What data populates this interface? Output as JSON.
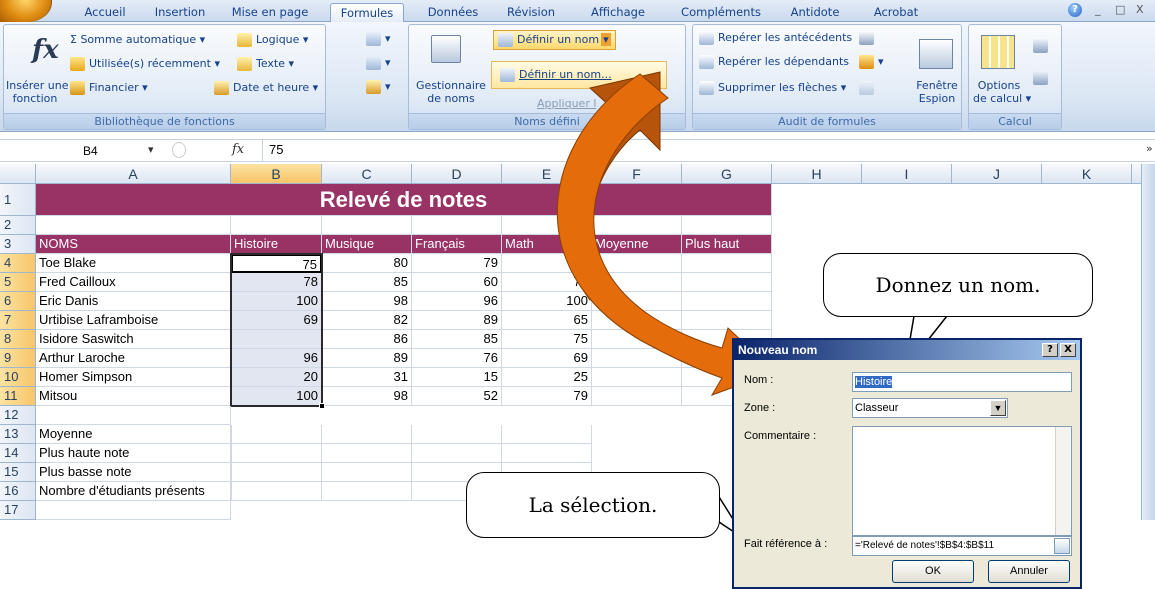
{
  "ribbon": {
    "tabs": [
      "Accueil",
      "Insertion",
      "Mise en page",
      "Formules",
      "Données",
      "Révision",
      "Affichage",
      "Compléments",
      "Antidote",
      "Acrobat"
    ],
    "active_tab": "Formules",
    "window_controls": [
      "_",
      "□",
      "X"
    ],
    "groups": {
      "library": {
        "label": "Bibliothèque de fonctions",
        "insert_function": [
          "Insérer une",
          "fonction"
        ],
        "fx": "fx",
        "autosum": "Σ Somme automatique ▾",
        "recent": "Utilisée(s) récemment ▾",
        "financial": "Financier ▾",
        "logical": "Logique ▾",
        "text": "Texte ▾",
        "datetime": "Date et heure ▾"
      },
      "names": {
        "label": "Noms défini",
        "manager": [
          "Gestionnaire",
          "de noms"
        ],
        "define_top": "Définir un nom",
        "define_dropdown": "Définir un nom...",
        "apply": "Appliquer l"
      },
      "audit": {
        "label": "Audit de formules",
        "precedents": "Repérer les antécédents",
        "dependents": "Repérer les dépendants",
        "remove_arrows": "Supprimer les flèches ▾",
        "watch": [
          "Fenêtre",
          "Espion"
        ]
      },
      "calc": {
        "label": "Calcul",
        "options": [
          "Options",
          "de calcul ▾"
        ]
      }
    }
  },
  "formula_bar": {
    "cell_ref": "B4",
    "fx": "fx",
    "value": "75"
  },
  "sheet": {
    "columns": [
      "A",
      "B",
      "C",
      "D",
      "E",
      "F",
      "G",
      "H",
      "I",
      "J",
      "K"
    ],
    "rows": [
      "1",
      "2",
      "3",
      "4",
      "5",
      "6",
      "7",
      "8",
      "9",
      "10",
      "11",
      "12",
      "13",
      "14",
      "15",
      "16",
      "17"
    ],
    "title": "Relevé de notes",
    "headers": [
      "NOMS",
      "Histoire",
      "Musique",
      "Français",
      "Math",
      "Moyenne",
      "Plus haut"
    ],
    "students": [
      {
        "name": "Toe Blake",
        "histoire": "75",
        "musique": "80",
        "francais": "79",
        "math": "8"
      },
      {
        "name": "Fred Cailloux",
        "histoire": "78",
        "musique": "85",
        "francais": "60",
        "math": "75"
      },
      {
        "name": "Eric Danis",
        "histoire": "100",
        "musique": "98",
        "francais": "96",
        "math": "100"
      },
      {
        "name": "Urtibise Laframboise",
        "histoire": "69",
        "musique": "82",
        "francais": "89",
        "math": "65"
      },
      {
        "name": "Isidore Saswitch",
        "histoire": "",
        "musique": "86",
        "francais": "85",
        "math": "75"
      },
      {
        "name": "Arthur Laroche",
        "histoire": "96",
        "musique": "89",
        "francais": "76",
        "math": "69"
      },
      {
        "name": "Homer Simpson",
        "histoire": "20",
        "musique": "31",
        "francais": "15",
        "math": "25"
      },
      {
        "name": "Mitsou",
        "histoire": "100",
        "musique": "98",
        "francais": "52",
        "math": "79"
      }
    ],
    "summary": [
      "Moyenne",
      "Plus haute note",
      "Plus basse note",
      "Nombre d'étudiants présents"
    ]
  },
  "callouts": {
    "name": "Donnez un nom.",
    "selection": "La sélection."
  },
  "dialog": {
    "title": "Nouveau nom",
    "help": "?",
    "close": "X",
    "name_label": "Nom :",
    "name_value": "Histoire",
    "scope_label": "Zone :",
    "scope_value": "Classeur",
    "comment_label": "Commentaire :",
    "refers_label": "Fait référence à :",
    "refers_value": "='Relevé de notes'!$B$4:$B$11",
    "ok": "OK",
    "cancel": "Annuler"
  },
  "colors": {
    "header_purple": "#993366",
    "arrow_orange": "#e46c0a",
    "arrow_dark": "#b5540a"
  }
}
